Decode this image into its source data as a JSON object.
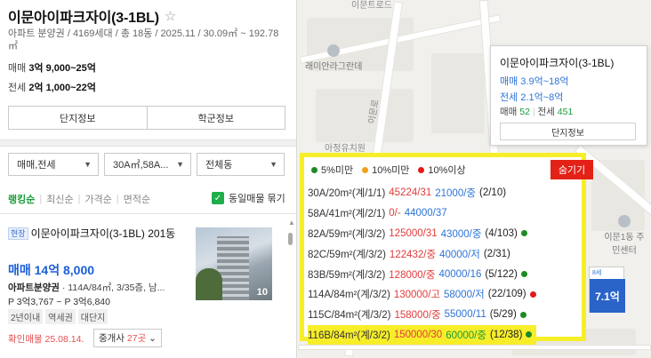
{
  "complex": {
    "title": "이문아이파크자이(3-1BL)",
    "info": "아파트 분양권 / 4169세대 / 총 18동 / 2025.11 / 30.09㎡ ~ 192.78㎡",
    "sale_label": "매매",
    "sale_value": "3억 9,000~25억",
    "rent_label": "전세",
    "rent_value": "2억 1,000~22억"
  },
  "buttons": {
    "complex_info": "단지정보",
    "school_info": "학군정보"
  },
  "filters": {
    "deal_type": "매매,전세",
    "area": "30A㎡,58A...",
    "building": "전체동"
  },
  "sort": {
    "items": [
      "랭킹순",
      "최신순",
      "가격순",
      "면적순"
    ],
    "dup_label": "동일매물 묶기"
  },
  "listing": {
    "badge": "현장",
    "title": "이문아이파크자이(3-1BL) 201동",
    "price": "매매 14억 8,000",
    "type_bold": "아파트분양권",
    "detail": " · 114A/84㎡, 3/35층, 남...",
    "range": "P 3억3,767 ~ P 3억6,840",
    "tags": [
      "2년이내",
      "역세권",
      "대단지"
    ],
    "confirm": "확인매물 25.08.14.",
    "broker_prefix": "중개사 ",
    "broker_count": "27곳",
    "broker_chev": "⌄",
    "photo_count": "10"
  },
  "map": {
    "labels": [
      "이문트로드",
      "래미안라그란데",
      "아정유치원",
      "이문로",
      "이문1동 주민센터"
    ],
    "marker_top": "8세",
    "marker_value": "7.1억"
  },
  "popup": {
    "title": "이문아이파크자이(3-1BL)",
    "sale": "매매 3.9억~18억",
    "rent": "전세 2.1억~8억",
    "counts_sale_label": "매매 ",
    "counts_sale": "52",
    "counts_rent_label": "전세 ",
    "counts_rent": "451",
    "button": "단지정보"
  },
  "overlay": {
    "legend": [
      {
        "label": "5%미만",
        "color": "#1e8a24"
      },
      {
        "label": "10%미만",
        "color": "#f0a020"
      },
      {
        "label": "10%이상",
        "color": "#e21a1a"
      }
    ],
    "hide_button": "숨기기",
    "rows": [
      {
        "type": "30A/20m²(계/1/1)",
        "sale": "45224/31",
        "rent": "21000/중",
        "count": "(2/10)",
        "status": "",
        "highlight": false
      },
      {
        "type": "58A/41m²(계/2/1)",
        "sale": "0/-",
        "rent": "44000/37",
        "count": "",
        "status": "",
        "highlight": false
      },
      {
        "type": "82A/59m²(계/3/2)",
        "sale": "125000/31",
        "rent": "43000/중",
        "count": "(4/103)",
        "status": "#1e8a24",
        "highlight": false
      },
      {
        "type": "82C/59m²(계/3/2)",
        "sale": "122432/중",
        "rent": "40000/저",
        "count": "(2/31)",
        "status": "",
        "highlight": false
      },
      {
        "type": "83B/59m²(계/3/2)",
        "sale": "128000/중",
        "rent": "40000/16",
        "count": "(5/122)",
        "status": "#1e8a24",
        "highlight": false
      },
      {
        "type": "114A/84m²(계/3/2)",
        "sale": "130000/고",
        "rent": "58000/저",
        "count": "(22/109)",
        "status": "#e21a1a",
        "highlight": false
      },
      {
        "type": "115C/84m²(계/3/2)",
        "sale": "158000/중",
        "rent": "55000/11",
        "count": "(5/29)",
        "status": "#1e8a24",
        "highlight": false
      },
      {
        "type": "116B/84m²(계/3/2)",
        "sale": "150000/30",
        "rent": "60000/중",
        "count": "(12/38)",
        "status": "#1e8a24",
        "highlight": true
      }
    ]
  }
}
